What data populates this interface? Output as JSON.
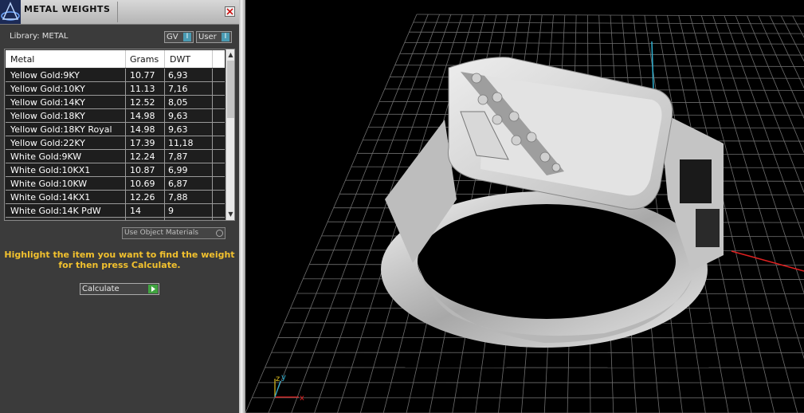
{
  "panel": {
    "title": "METAL WEIGHTS",
    "library_label": "Library: METAL",
    "gv_label": "GV",
    "user_label": "User",
    "toggle_glyph": "I",
    "columns": [
      "Metal",
      "Grams",
      "DWT"
    ],
    "rows": [
      [
        "Yellow Gold:9KY",
        "10.77",
        "6,93"
      ],
      [
        "Yellow Gold:10KY",
        "11.13",
        "7,16"
      ],
      [
        "Yellow Gold:14KY",
        "12.52",
        "8,05"
      ],
      [
        "Yellow Gold:18KY",
        "14.98",
        "9,63"
      ],
      [
        "Yellow Gold:18KY Royal",
        "14.98",
        "9,63"
      ],
      [
        "Yellow Gold:22KY",
        "17.39",
        "11,18"
      ],
      [
        "White Gold:9KW",
        "12.24",
        "7,87"
      ],
      [
        "White Gold:10KX1",
        "10.87",
        "6,99"
      ],
      [
        "White Gold:10KW",
        "10.69",
        "6,87"
      ],
      [
        "White Gold:14KX1",
        "12.26",
        "7,88"
      ],
      [
        "White Gold:14K PdW",
        "14",
        "9"
      ]
    ],
    "use_object_materials": "Use Object Materials",
    "instructions_line1": "Highlight the item you want to find the weight",
    "instructions_line2": "for then press Calculate.",
    "calculate_label": "Calculate"
  },
  "viewport": {
    "axis_labels": {
      "z": "z",
      "y": "y",
      "x": "x"
    },
    "colors": {
      "grid": "#6e6e6e",
      "x_axis": "#e02020",
      "y_axis": "#30b0d0",
      "z_axis": "#e0c020",
      "ring": "#cfcfcf"
    },
    "content": "ring-3d-model"
  },
  "icons": {
    "logo": "app-logo-icon",
    "close": "close-icon",
    "scroll_up": "scroll-up-icon",
    "scroll_down": "scroll-down-icon",
    "calculate_go": "play-icon"
  }
}
